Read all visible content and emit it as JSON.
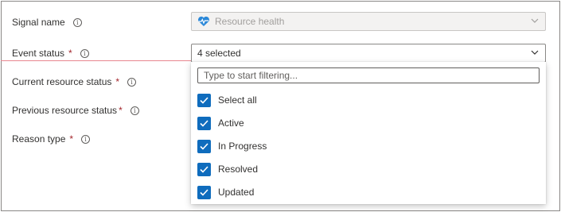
{
  "fields": {
    "signal_name": {
      "label": "Signal name",
      "value": "Resource health"
    },
    "event_status": {
      "label": "Event status",
      "required_mark": "*",
      "value": "4 selected"
    },
    "current_resource_status": {
      "label": "Current resource status",
      "required_mark": "*"
    },
    "previous_resource_status": {
      "label": "Previous resource status",
      "required_mark": "*"
    },
    "reason_type": {
      "label": "Reason type",
      "required_mark": "*"
    }
  },
  "info_glyph": "i",
  "dropdown": {
    "filter_placeholder": "Type to start filtering...",
    "options": [
      {
        "label": "Select all",
        "checked": true
      },
      {
        "label": "Active",
        "checked": true
      },
      {
        "label": "In Progress",
        "checked": true
      },
      {
        "label": "Resolved",
        "checked": true
      },
      {
        "label": "Updated",
        "checked": true
      }
    ]
  },
  "colors": {
    "accent": "#0f6cbd",
    "required": "#a4262c",
    "error_underline": "#e8868f",
    "heart_icon": "#2b88d8"
  },
  "icons": {
    "signal_icon": "heart-pulse-icon",
    "dropdown_icon": "chevron-down-icon",
    "info_icon": "info-icon",
    "check_icon": "checkmark-icon"
  }
}
